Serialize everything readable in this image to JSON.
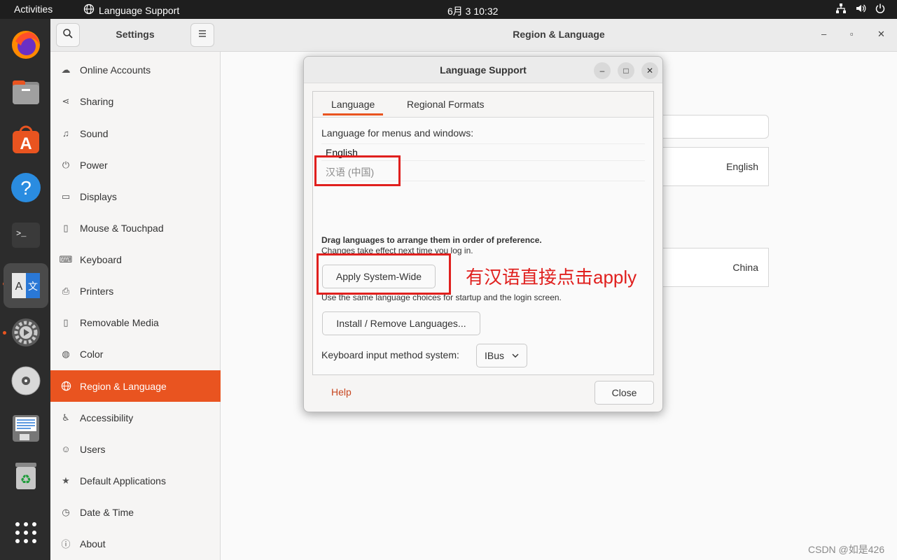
{
  "topbar": {
    "activities": "Activities",
    "app_name": "Language Support",
    "clock": "6月 3  10:32"
  },
  "dock": {
    "items": [
      "firefox-icon",
      "files-icon",
      "software-center-icon",
      "help-icon",
      "terminal-icon",
      "language-support-icon",
      "settings-icon",
      "cd-drive-icon",
      "text-editor-icon",
      "trash-icon",
      "app-grid-icon"
    ]
  },
  "sidebar": {
    "title": "Settings",
    "items": [
      {
        "label": "Online Accounts",
        "icon": "cloud-icon"
      },
      {
        "label": "Sharing",
        "icon": "share-icon"
      },
      {
        "label": "Sound",
        "icon": "music-icon"
      },
      {
        "label": "Power",
        "icon": "power-icon"
      },
      {
        "label": "Displays",
        "icon": "display-icon"
      },
      {
        "label": "Mouse & Touchpad",
        "icon": "mouse-icon"
      },
      {
        "label": "Keyboard",
        "icon": "keyboard-icon"
      },
      {
        "label": "Printers",
        "icon": "printer-icon"
      },
      {
        "label": "Removable Media",
        "icon": "usb-icon"
      },
      {
        "label": "Color",
        "icon": "color-icon"
      },
      {
        "label": "Region & Language",
        "icon": "globe-icon",
        "active": true
      },
      {
        "label": "Accessibility",
        "icon": "accessibility-icon"
      },
      {
        "label": "Users",
        "icon": "users-icon"
      },
      {
        "label": "Default Applications",
        "icon": "star-icon"
      },
      {
        "label": "Date & Time",
        "icon": "clock-icon"
      },
      {
        "label": "About",
        "icon": "info-icon"
      }
    ]
  },
  "main": {
    "title": "Region & Language",
    "language_value": "English",
    "formats_value": "China"
  },
  "dialog": {
    "title": "Language Support",
    "tabs": [
      {
        "label": "Language"
      },
      {
        "label": "Regional Formats"
      }
    ],
    "menus_label": "Language for menus and windows:",
    "languages": [
      {
        "label": "English"
      },
      {
        "label": "汉语 (中国)"
      }
    ],
    "drag_hint": "Drag languages to arrange them in order of preference.",
    "changes_hint": "Changes take effect next time you log in.",
    "apply_button": "Apply System-Wide",
    "apply_hint": "Use the same language choices for startup and the login screen.",
    "install_button": "Install / Remove Languages...",
    "input_method_label": "Keyboard input method system:",
    "input_method_value": "IBus",
    "help_button": "Help",
    "close_button": "Close"
  },
  "annotation": "有汉语直接点击apply",
  "watermark": "CSDN @如是426",
  "colors": {
    "accent": "#e95420",
    "annotation": "#e0201e"
  }
}
